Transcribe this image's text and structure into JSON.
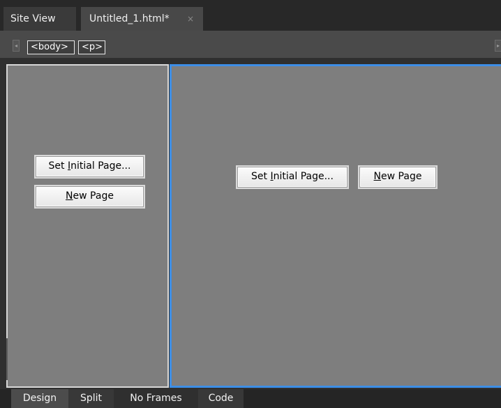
{
  "tabs": {
    "site_view": "Site View",
    "document": "Untitled_1.html*",
    "close_glyph": "×"
  },
  "tag_selector": {
    "scroll_left": "◂",
    "scroll_right": "▸",
    "tags": [
      "<body>",
      "<p>"
    ]
  },
  "frames": {
    "left": {
      "set_initial_page": {
        "pre": "Set ",
        "mnemonic": "I",
        "post": "nitial Page..."
      },
      "new_page": {
        "pre": "",
        "mnemonic": "N",
        "post": "ew Page"
      }
    },
    "right": {
      "set_initial_page": {
        "pre": "Set ",
        "mnemonic": "I",
        "post": "nitial Page..."
      },
      "new_page": {
        "pre": "",
        "mnemonic": "N",
        "post": "ew Page"
      }
    },
    "selected_frame_color": "#3d8ee6"
  },
  "view_tabs": [
    "Design",
    "Split",
    "No Frames",
    "Code"
  ]
}
